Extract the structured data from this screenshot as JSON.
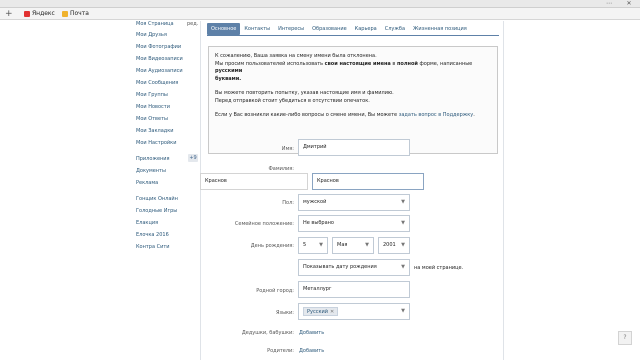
{
  "browser": {
    "controls": [
      "⋯",
      "✕"
    ]
  },
  "bookmarks": {
    "add_icon": "plus-icon",
    "items": [
      {
        "label": "Яндекс",
        "color": "#e13232"
      },
      {
        "label": "Почта",
        "color": "#f0b32e"
      }
    ]
  },
  "sidebar": {
    "items": [
      "Моя Страница",
      "Мои Друзья",
      "Мои Фотографии",
      "Мои Видеозаписи",
      "Мои Аудиозаписи",
      "Мои Сообщения",
      "Мои Группы",
      "Мои Новости",
      "Мои Ответы",
      "Мои Закладки",
      "Мои Настройки",
      "Приложения",
      "Документы",
      "Реклама",
      "Гонщик Онлайн",
      "Голодные Игры",
      "Елакция",
      "Елочка 2016",
      "Контра Сити"
    ],
    "edit_label": "ред.",
    "apps_badge": "+9"
  },
  "tabs": [
    "Основное",
    "Контакты",
    "Интересы",
    "Образование",
    "Карьера",
    "Служба",
    "Жизненная позиция"
  ],
  "notice": {
    "line1": "К сожалению, Ваша заявка на смену имени была отклонена.",
    "line2_a": "Мы просим пользователей использовать ",
    "line2_b": "свои настоящие имена",
    "line2_c": " в ",
    "line2_d": "полной",
    "line2_e": " форме, написанные ",
    "line2_f": "русскими",
    "line3": "буквами.",
    "line4": "Вы можете повторить попытку, указав настоящие имя и фамилию.",
    "line5": "Перед отправкой стоит убедиться в отсутствии опечаток.",
    "line6_a": "Если у Вас возникли какие-либо вопросы о смене имени, Вы можете ",
    "line6_b": "задать вопрос в Поддержку",
    "line6_c": "."
  },
  "form": {
    "name_label": "Имя:",
    "name_value": "Дмитрий",
    "surname_label": "Фамилия:",
    "surname_ghost": "Краснов",
    "surname_value": "Краснов",
    "gender_label": "Пол:",
    "gender_value": "мужской",
    "marital_label": "Семейное положение:",
    "marital_value": "Не выбрано",
    "birthday_label": "День рождения:",
    "birthday_day": "5",
    "birthday_month": "Мая",
    "birthday_year": "2001",
    "birthday_visibility": "Показывать дату рождения",
    "birthday_visibility_note": "на моей странице.",
    "hometown_label": "Родной город:",
    "hometown_value": "Металлург",
    "languages_label": "Языки:",
    "language_tag": "Русский",
    "grandparents_label": "Дедушки, бабушки:",
    "grandparents_action": "Добавить",
    "parents_label": "Родители:",
    "parents_action": "Добавить"
  },
  "corner_button": "?"
}
